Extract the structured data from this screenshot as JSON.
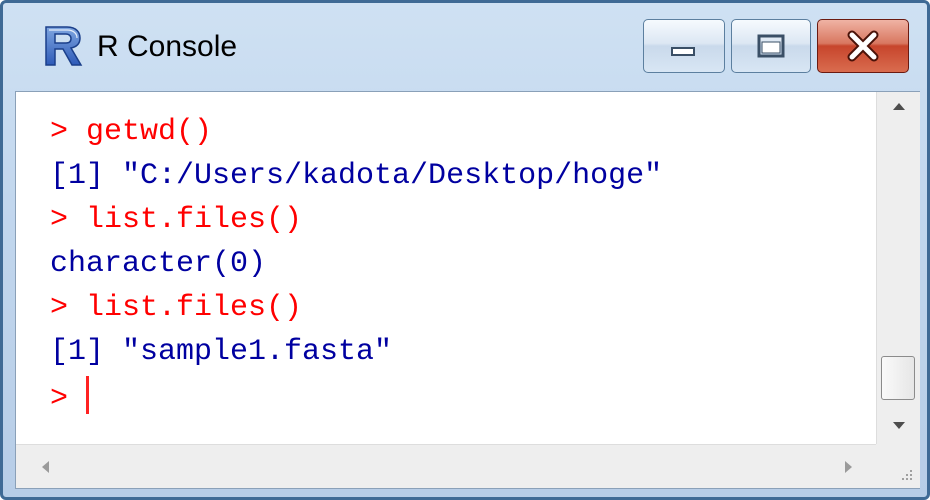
{
  "window": {
    "title": "R Console",
    "icon": "r-logo-icon",
    "controls": [
      "minimize-icon",
      "maximize-icon",
      "close-icon"
    ]
  },
  "console": {
    "lines": [
      {
        "type": "command",
        "text": "> getwd()"
      },
      {
        "type": "output",
        "text": "[1] \"C:/Users/kadota/Desktop/hoge\""
      },
      {
        "type": "command",
        "text": "> list.files()"
      },
      {
        "type": "output",
        "text": "character(0)"
      },
      {
        "type": "command",
        "text": "> list.files()"
      },
      {
        "type": "output",
        "text": "[1] \"sample1.fasta\""
      }
    ],
    "prompt": "> "
  },
  "colors": {
    "command": "#ff0000",
    "output": "#0000a0",
    "titlebar": "#c2d7ee",
    "close_button": "#c7452c"
  }
}
